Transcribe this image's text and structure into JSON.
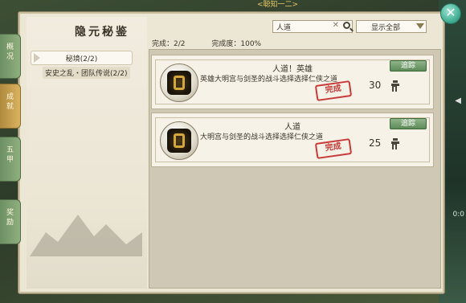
{
  "top_hint": "<聪知一二>",
  "right_edge": {
    "arrow": "◀",
    "label": "0:0"
  },
  "window": {
    "title": "隐元秘鉴",
    "close_label": "✕"
  },
  "side_tabs": [
    {
      "label": "概\n况",
      "active": false
    },
    {
      "label": "成\n就",
      "active": true
    },
    {
      "label": "五\n甲",
      "active": false
    },
    {
      "label": "奖\n励",
      "active": false
    }
  ],
  "tree": {
    "selected": "秘境(2/2)",
    "sub": "安史之乱・团队传说(2/2)"
  },
  "search": {
    "value": "人道",
    "clear": "✕"
  },
  "filter": {
    "label": "显示全部"
  },
  "stats": {
    "completed": "完成：2/2",
    "progress": "完成度：100%"
  },
  "cards": [
    {
      "title": "人道！英雄",
      "desc": "英雄大明宫与剑圣的战斗选择选择仁侠之道",
      "points": "30",
      "track": "追踪",
      "stamp": "完成"
    },
    {
      "title": "人道",
      "desc": "大明宫与剑圣的战斗选择选择仁侠之道",
      "points": "25",
      "track": "追踪",
      "stamp": "完成"
    }
  ],
  "colors": {
    "accent_green": "#5d8a58",
    "stamp_red": "#c63a3a",
    "tab_active": "#d9b35f"
  }
}
